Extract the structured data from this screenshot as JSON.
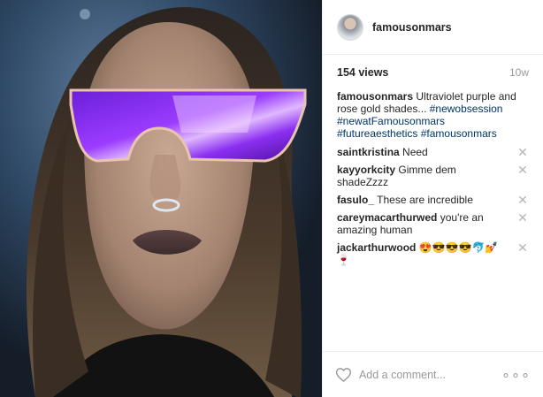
{
  "post": {
    "media_alt": "Video of a person wearing ultraviolet purple mirrored shield sunglasses",
    "author": {
      "username": "famousonmars"
    },
    "views": "154 views",
    "age": "10w",
    "caption": {
      "username": "famousonmars",
      "text": "Ultraviolet purple and rose gold shades... ",
      "hashtags": [
        "#newobsession",
        "#newatFamousonmars",
        "#futureaesthetics",
        "#famousonmars"
      ]
    },
    "comments": [
      {
        "username": "saintkristina",
        "text": "Need"
      },
      {
        "username": "kayyorkcity",
        "text": "Gimme dem shadeZzzz"
      },
      {
        "username": "fasulo_",
        "text": "These are incredible"
      },
      {
        "username": "careymacarthurwed",
        "text": "you're an amazing human"
      },
      {
        "username": "jackarthurwood",
        "text": "😍😎😎😎🐬💅🍷"
      }
    ],
    "remove_glyph": "✕",
    "add_comment_placeholder": "Add a comment...",
    "more_options_glyph": "∘∘∘",
    "icons": {
      "like": "heart-outline-icon",
      "remove": "close-icon",
      "more": "more-options-icon"
    }
  }
}
